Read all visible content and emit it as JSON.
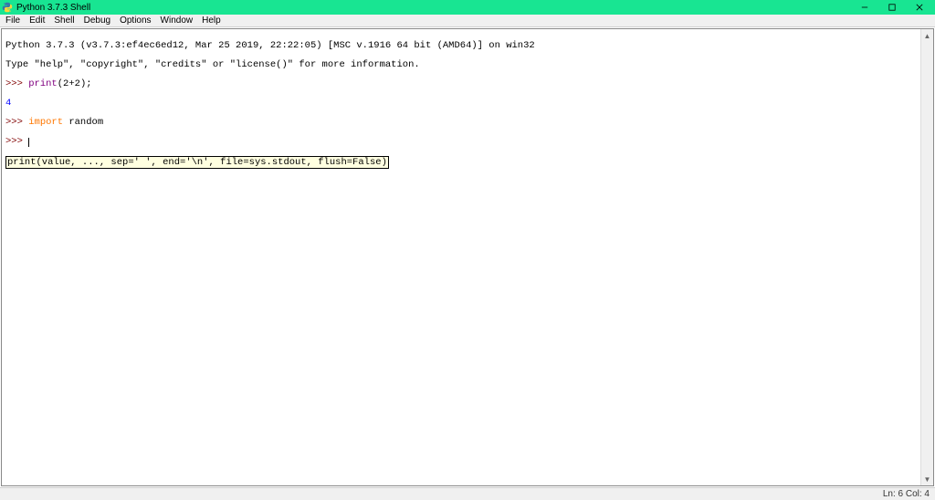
{
  "titlebar": {
    "title": "Python 3.7.3 Shell"
  },
  "menubar": {
    "items": [
      "File",
      "Edit",
      "Shell",
      "Debug",
      "Options",
      "Window",
      "Help"
    ]
  },
  "editor": {
    "line1": "Python 3.7.3 (v3.7.3:ef4ec6ed12, Mar 25 2019, 22:22:05) [MSC v.1916 64 bit (AMD64)] on win32",
    "line2": "Type \"help\", \"copyright\", \"credits\" or \"license()\" for more information.",
    "prompt": ">>> ",
    "line3_call": "print",
    "line3_args": "(2+2);",
    "line4_output": "4",
    "line5_kw": "import",
    "line5_mod": " random",
    "tooltip": "print(value, ..., sep=' ', end='\\n', file=sys.stdout, flush=False)"
  },
  "statusbar": {
    "pos": "Ln: 6  Col: 4"
  }
}
